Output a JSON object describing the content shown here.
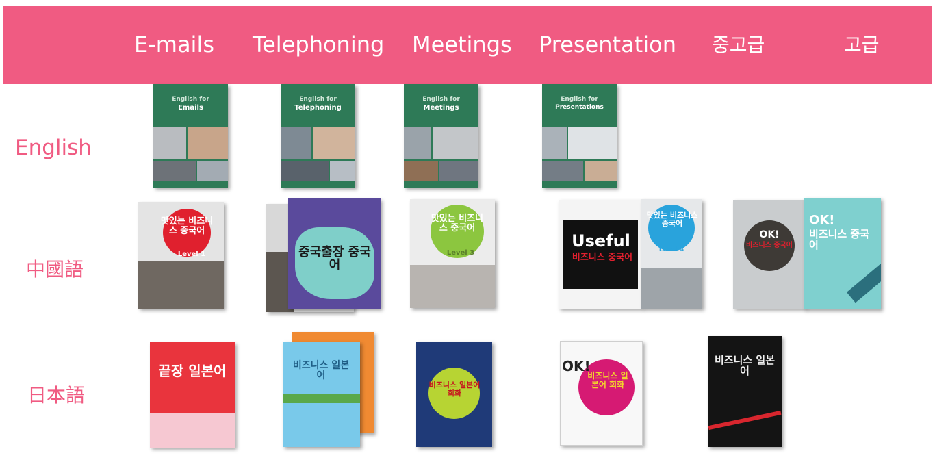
{
  "nav": {
    "items": [
      {
        "label": "E-mails"
      },
      {
        "label": "Telephoning"
      },
      {
        "label": "Meetings"
      },
      {
        "label": "Presentation"
      },
      {
        "label": "중고급"
      },
      {
        "label": "고급"
      }
    ]
  },
  "rows": {
    "english": {
      "label": "English"
    },
    "chinese": {
      "label": "中國語"
    },
    "japanese": {
      "label": "日本語"
    }
  },
  "books": {
    "en_emails": {
      "title1": "English for",
      "title2": "Emails"
    },
    "en_telephoning": {
      "title1": "English for",
      "title2": "Telephoning"
    },
    "en_meetings": {
      "title1": "English for",
      "title2": "Meetings"
    },
    "en_presentations": {
      "title1": "English for",
      "title2": "Presentations"
    },
    "zh_1": {
      "title": "맛있는 비즈니스 중국어",
      "level": "Level 1"
    },
    "zh_2": {
      "title": "중국출장 중국어"
    },
    "zh_3": {
      "title": "맛있는 비즈니스 중국어",
      "level": "Level 3"
    },
    "zh_4a": {
      "title1": "Useful",
      "title2": "비즈니스 중국어"
    },
    "zh_4b": {
      "title": "맛있는 비즈니스 중국어",
      "level": "Level 4"
    },
    "zh_5a": {
      "title1": "OK!",
      "title2": "비즈니스 중국어"
    },
    "zh_5b": {
      "title1": "OK!",
      "title2": "비즈니스 중국어"
    },
    "ja_1": {
      "title": "끝장 일본어"
    },
    "ja_2": {
      "title": "비즈니스 일본어"
    },
    "ja_3": {
      "title": "비즈니스 일본어 회화"
    },
    "ja_4": {
      "title1": "OK!",
      "title2": "비즈니스 일본어 회화"
    },
    "ja_5": {
      "title": "비즈니스 일본어"
    }
  },
  "colors": {
    "brand": "#f05b82",
    "english_cover": "#2e7a57"
  }
}
